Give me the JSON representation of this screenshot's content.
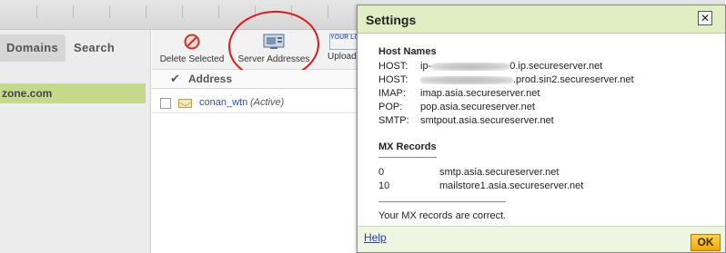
{
  "app": {
    "left_tabs": [
      "Domains",
      "Search"
    ],
    "selected_domain": "zone.com",
    "toolbar": {
      "delete_label": "Delete Selected",
      "server_label": "Server Addresses",
      "upload_label": "Upload L",
      "logo_text": "YOUR LOGO"
    },
    "list": {
      "column_header": "Address",
      "rows": [
        {
          "name": "conan_wtn",
          "status": "(Active)"
        }
      ]
    }
  },
  "dialog": {
    "title": "Settings",
    "close_glyph": "✕",
    "host_names": {
      "heading": "Host Names",
      "lines": [
        {
          "label": "HOST:",
          "prefix": "ip-",
          "suffix": "0.ip.secureserver.net"
        },
        {
          "label": "HOST:",
          "prefix": "",
          "suffix": ".prod.sin2.secureserver.net"
        },
        {
          "label": "IMAP:",
          "prefix": "",
          "suffix": "imap.asia.secureserver.net"
        },
        {
          "label": "POP:",
          "prefix": "",
          "suffix": "pop.asia.secureserver.net"
        },
        {
          "label": "SMTP:",
          "prefix": "",
          "suffix": "smtpout.asia.secureserver.net"
        }
      ]
    },
    "mx_records": {
      "heading": "MX Records",
      "rows": [
        {
          "priority": "0",
          "host": "smtp.asia.secureserver.net"
        },
        {
          "priority": "10",
          "host": "mailstore1.asia.secureserver.net"
        }
      ],
      "status": "Your MX records are correct."
    },
    "footer": {
      "help_label": "Help",
      "ok_label": "OK"
    }
  },
  "colors": {
    "title_bar": "#dfeec3",
    "selection": "#c4d98a",
    "annotation": "#e01818",
    "link": "#1a3fc0",
    "ok_button": "#f2a900"
  }
}
